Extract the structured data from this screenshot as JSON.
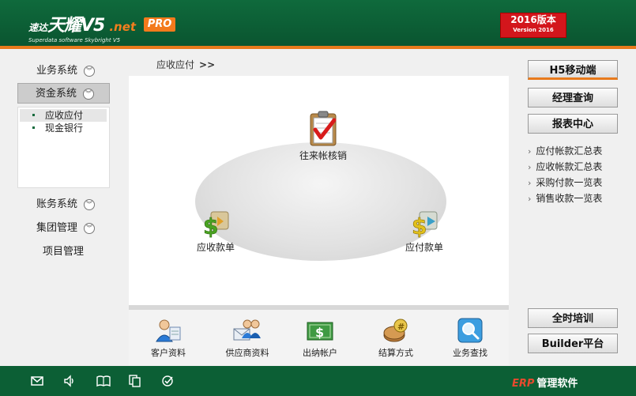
{
  "header": {
    "logo_small": "速达",
    "logo_big": "天耀V5",
    "logo_net": ".net",
    "logo_sub": "Superdata software Skybright V5",
    "pro_badge": "PRO",
    "version_year": "2016版本",
    "version_sub": "Version 2016"
  },
  "sidebar": {
    "items": [
      {
        "label": "业务系统"
      },
      {
        "label": "资金系统"
      },
      {
        "label": "账务系统"
      },
      {
        "label": "集团管理"
      },
      {
        "label": "项目管理"
      }
    ],
    "submenu": [
      {
        "label": "应收应付"
      },
      {
        "label": "现金银行"
      }
    ]
  },
  "breadcrumb": {
    "label": "应收应付",
    "arrow": ">>"
  },
  "flow": {
    "nodes": [
      {
        "label": "往来帐核销",
        "icon": "clipboard-check-icon"
      },
      {
        "label": "应收款单",
        "icon": "money-in-icon"
      },
      {
        "label": "应付款单",
        "icon": "money-out-icon"
      }
    ]
  },
  "tools": [
    {
      "label": "客户资料",
      "icon": "customer-icon"
    },
    {
      "label": "供应商资料",
      "icon": "supplier-icon"
    },
    {
      "label": "出纳帐户",
      "icon": "cash-account-icon"
    },
    {
      "label": "结算方式",
      "icon": "settlement-icon"
    },
    {
      "label": "业务查找",
      "icon": "search-icon"
    }
  ],
  "right": {
    "buttons": [
      {
        "label": "H5移动端"
      },
      {
        "label": "经理查询"
      },
      {
        "label": "报表中心"
      }
    ],
    "links": [
      {
        "label": "应付帐款汇总表"
      },
      {
        "label": "应收帐款汇总表"
      },
      {
        "label": "采购付款一览表"
      },
      {
        "label": "销售收款一览表"
      }
    ],
    "bottom_buttons": [
      {
        "label": "全时培训"
      },
      {
        "label": "Builder平台"
      }
    ]
  },
  "footer": {
    "erp": "ERP",
    "text": "管理软件",
    "icons": [
      "mail-icon",
      "sound-icon",
      "book-icon",
      "copy-icon",
      "check-circle-icon"
    ]
  },
  "colors": {
    "brand_green": "#0c5f35",
    "accent_orange": "#e87a1c",
    "badge_red": "#d3161c"
  }
}
